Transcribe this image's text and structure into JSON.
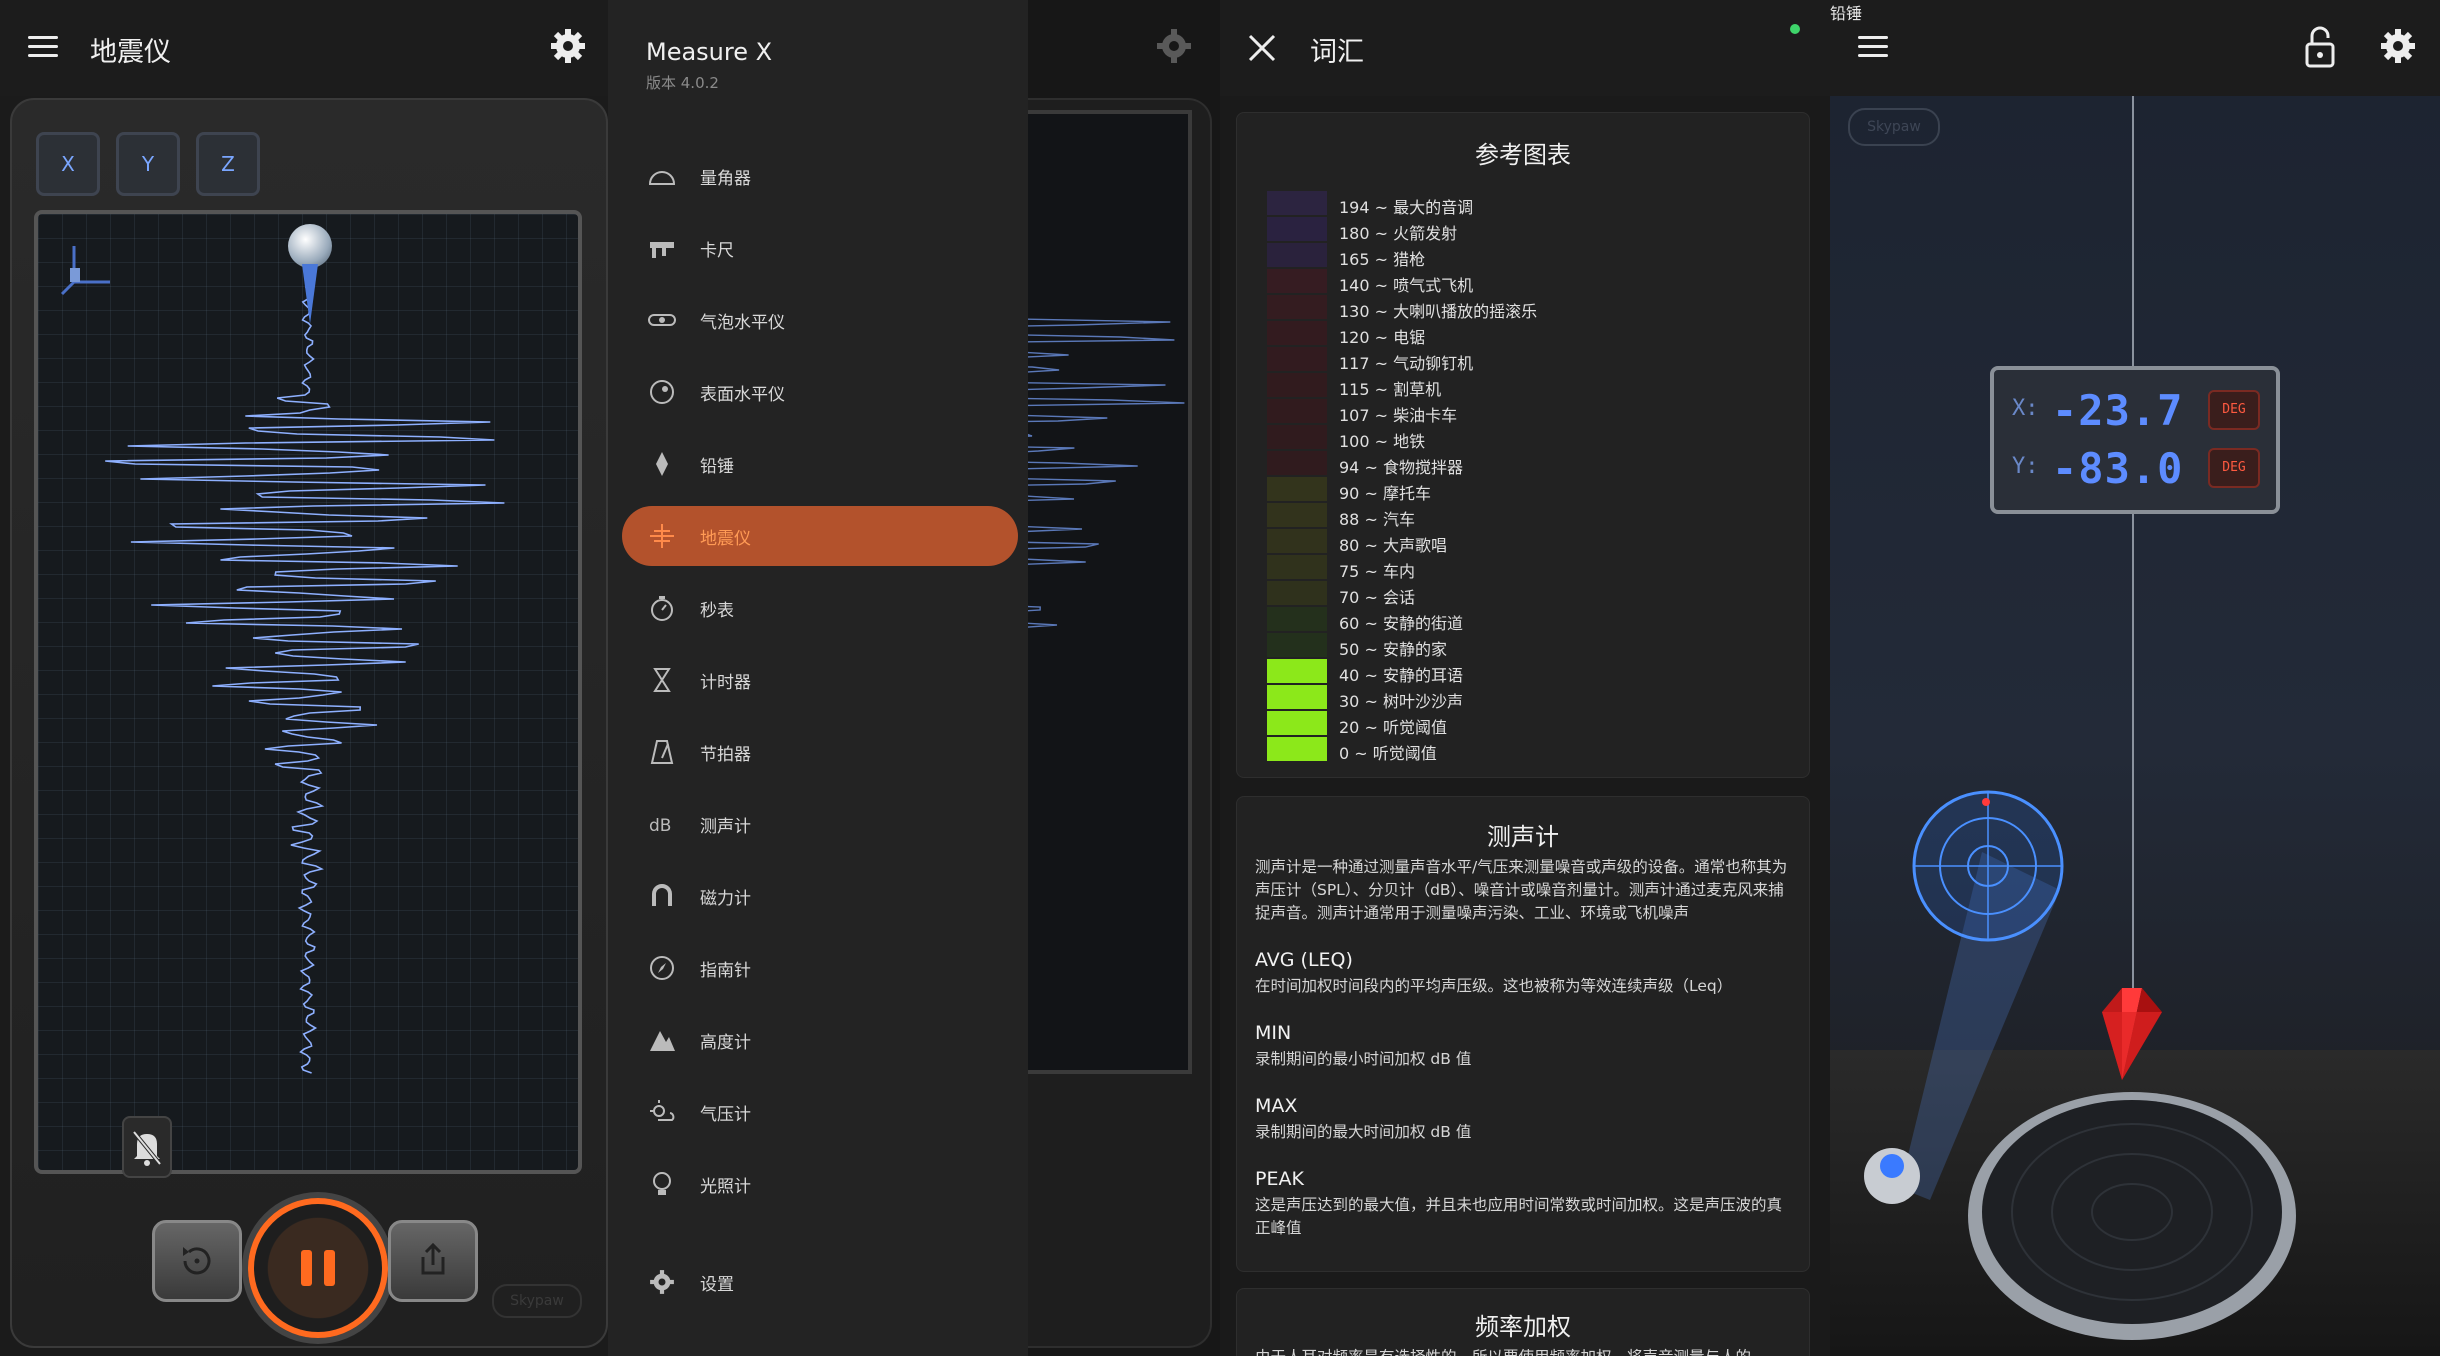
{
  "seismometer": {
    "title": "地震仪",
    "axes": [
      "X",
      "Y",
      "Z"
    ],
    "brand": "Skypaw"
  },
  "drawer": {
    "app_name": "Measure X",
    "version": "版本 4.0.2",
    "items": [
      {
        "label": "量角器",
        "icon": "protractor-icon"
      },
      {
        "label": "卡尺",
        "icon": "caliper-icon"
      },
      {
        "label": "气泡水平仪",
        "icon": "bubble-level-icon"
      },
      {
        "label": "表面水平仪",
        "icon": "surface-level-icon"
      },
      {
        "label": "铅锤",
        "icon": "plumb-bob-icon"
      },
      {
        "label": "地震仪",
        "icon": "seismometer-icon",
        "active": true
      },
      {
        "label": "秒表",
        "icon": "stopwatch-icon"
      },
      {
        "label": "计时器",
        "icon": "hourglass-icon"
      },
      {
        "label": "节拍器",
        "icon": "metronome-icon"
      },
      {
        "label": "测声计",
        "icon": "decibel-icon"
      },
      {
        "label": "磁力计",
        "icon": "magnet-icon"
      },
      {
        "label": "指南针",
        "icon": "compass-icon"
      },
      {
        "label": "高度计",
        "icon": "altimeter-icon"
      },
      {
        "label": "气压计",
        "icon": "barometer-icon"
      },
      {
        "label": "光照计",
        "icon": "light-meter-icon"
      }
    ],
    "settings_label": "设置",
    "active_color": "#b3522c"
  },
  "glossary": {
    "title": "词汇",
    "reference_title": "参考图表",
    "legend": [
      {
        "value": "194 ~",
        "label": "最大的音调",
        "color": "#2c2440"
      },
      {
        "value": "180 ~",
        "label": "火箭发射",
        "color": "#2a2240"
      },
      {
        "value": "165 ~",
        "label": "猎枪",
        "color": "#2a223c"
      },
      {
        "value": "140 ~",
        "label": "喷气式飞机",
        "color": "#361c22"
      },
      {
        "value": "130 ~",
        "label": "大喇叭播放的摇滚乐",
        "color": "#341c20"
      },
      {
        "value": "120 ~",
        "label": "电锯",
        "color": "#331b1f"
      },
      {
        "value": "117 ~",
        "label": "气动铆钉机",
        "color": "#321b1f"
      },
      {
        "value": "115 ~",
        "label": "割草机",
        "color": "#311b1e"
      },
      {
        "value": "107 ~",
        "label": "柴油卡车",
        "color": "#311b1e"
      },
      {
        "value": "100 ~",
        "label": "地铁",
        "color": "#301b1e"
      },
      {
        "value": "94 ~",
        "label": "食物搅拌器",
        "color": "#301b1e"
      },
      {
        "value": "90 ~",
        "label": "摩托车",
        "color": "#33341c"
      },
      {
        "value": "88 ~",
        "label": "汽车",
        "color": "#32331c"
      },
      {
        "value": "80 ~",
        "label": "大声歌唱",
        "color": "#31321c"
      },
      {
        "value": "75 ~",
        "label": "车内",
        "color": "#30321c"
      },
      {
        "value": "70 ~",
        "label": "会话",
        "color": "#2f311c"
      },
      {
        "value": "60 ~",
        "label": "安静的街道",
        "color": "#24301c"
      },
      {
        "value": "50 ~",
        "label": "安静的家",
        "color": "#23301c"
      },
      {
        "value": "40 ~",
        "label": "安静的耳语",
        "color": "#8ce81a"
      },
      {
        "value": "30 ~",
        "label": "树叶沙沙声",
        "color": "#8ce81a"
      },
      {
        "value": "20 ~",
        "label": "听觉阈值",
        "color": "#8ce81a"
      },
      {
        "value": "0 ~",
        "label": "听觉阈值",
        "color": "#8ce81a"
      }
    ],
    "meter_title": "测声计",
    "meter_desc": "测声计是一种通过测量声音水平/气压来测量噪音或声级的设备。通常也称其为声压计（SPL）、分贝计（dB）、噪音计或噪音剂量计。测声计通过麦克风来捕捉声音。测声计通常用于测量噪声污染、工业、环境或飞机噪声",
    "terms": [
      {
        "name": "AVG (LEQ)",
        "desc": "在时间加权时间段内的平均声压级。这也被称为等效连续声级（Leq）"
      },
      {
        "name": "MIN",
        "desc": "录制期间的最小时间加权 dB 值"
      },
      {
        "name": "MAX",
        "desc": "录制期间的最大时间加权 dB 值"
      },
      {
        "name": "PEAK",
        "desc": "这是声压达到的最大值，并且未也应用时间常数或时间加权。这是声压波的真正峰值"
      }
    ],
    "freq_title": "频率加权",
    "freq_desc": "由于人耳对频率是有选择性的，所以要使用频率加权，将声音测量与人的"
  },
  "plumb": {
    "title": "铅锤",
    "x_label": "X:",
    "x_value": "-23.7",
    "y_label": "Y:",
    "y_value": "-83.0",
    "unit": "DEG",
    "brand": "Skypaw"
  }
}
